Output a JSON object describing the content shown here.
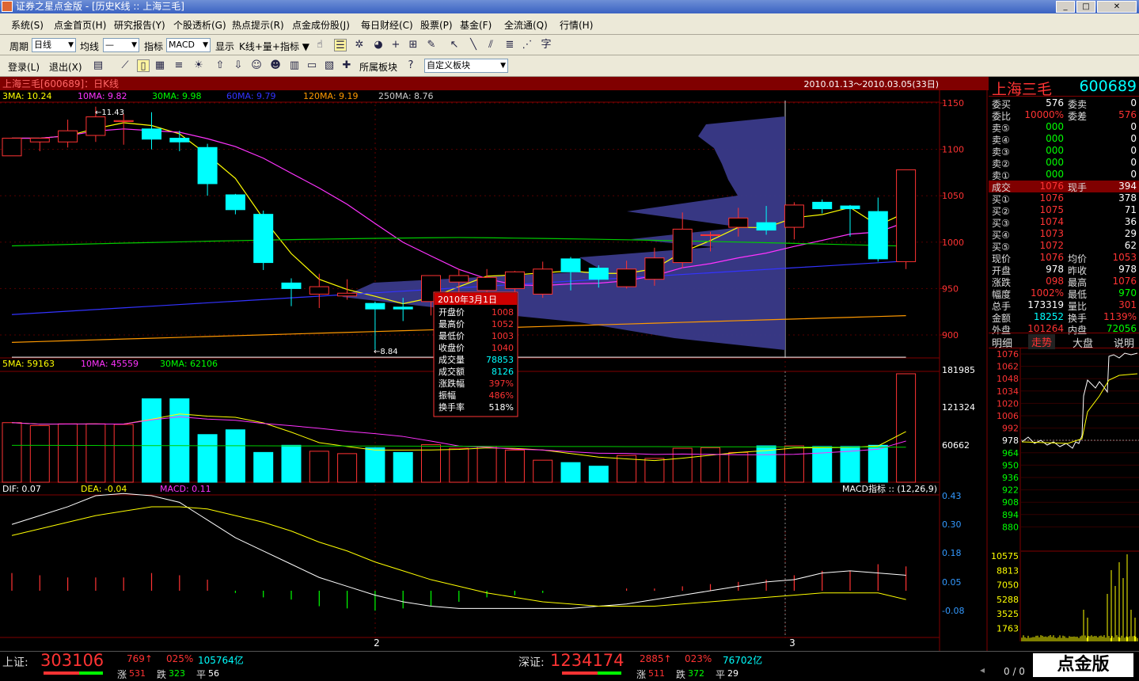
{
  "window": {
    "title": "证券之星点金版 - [历史K线 :: 上海三毛]"
  },
  "menu": [
    "系统(S)",
    "点金首页(H)",
    "研究报告(Y)",
    "个股透析(G)",
    "热点提示(R)",
    "点金成份股(J)",
    "每日财经(C)",
    "股票(P)",
    "基金(F)",
    "全流通(Q)",
    "行情(H)"
  ],
  "toolbar1": {
    "period_label": "周期",
    "period_value": "日线",
    "ma_label": "均线",
    "ma_value": "—",
    "indicator_label": "指标",
    "indicator_value": "MACD",
    "show_label": "显示",
    "show_value": "K线+量+指标",
    "char_icon": "字"
  },
  "toolbar2": {
    "login": "登录(L)",
    "logout": "退出(X)",
    "sector": "所属板块",
    "custom": "自定义板块"
  },
  "chart": {
    "stock_title": "上海三毛[600689]：日K线",
    "date_range": "2010.01.13～2010.03.05(33日)",
    "ma_labels": [
      {
        "t": "3MA: 10.24",
        "c": "#ffff00"
      },
      {
        "t": "10MA: 9.82",
        "c": "#ff33ff"
      },
      {
        "t": "30MA: 9.98",
        "c": "#00ff00"
      },
      {
        "t": "60MA: 9.79",
        "c": "#3333ff"
      },
      {
        "t": "120MA: 9.19",
        "c": "#ff9900"
      },
      {
        "t": "250MA: 8.76",
        "c": "#cccccc"
      }
    ],
    "price_axis": [
      "1150",
      "1100",
      "1050",
      "1000",
      "950",
      "900"
    ],
    "high_mark": "11.43",
    "low_mark": "8.84",
    "vol_labels": [
      {
        "t": "5MA: 59163",
        "c": "#ffff00"
      },
      {
        "t": "10MA: 45559",
        "c": "#ff33ff"
      },
      {
        "t": "30MA: 62106",
        "c": "#00ff00"
      }
    ],
    "vol_axis": [
      "181985",
      "121324",
      "60662"
    ],
    "macd_labels": [
      {
        "t": "DIF: 0.07",
        "c": "#ffffff"
      },
      {
        "t": "DEA: -0.04",
        "c": "#ffff00"
      },
      {
        "t": "MACD: 0.11",
        "c": "#ff33ff"
      }
    ],
    "macd_title": "MACD指标 :: (12,26,9)",
    "macd_axis": [
      "0.43",
      "0.30",
      "0.18",
      "0.05",
      "-0.08"
    ],
    "x_labels": [
      "2",
      "3"
    ],
    "candles": [
      {
        "o": 10.93,
        "c": 11.12,
        "h": 11.12,
        "l": 10.93
      },
      {
        "o": 11.08,
        "c": 11.12,
        "h": 11.12,
        "l": 10.98
      },
      {
        "o": 11.08,
        "c": 11.2,
        "h": 11.32,
        "l": 11.02
      },
      {
        "o": 11.15,
        "c": 11.35,
        "h": 11.46,
        "l": 11.08
      },
      {
        "o": 11.3,
        "c": 11.31,
        "h": 11.38,
        "l": 11.05
      },
      {
        "o": 11.22,
        "c": 11.11,
        "h": 11.4,
        "l": 11.0
      },
      {
        "o": 11.12,
        "c": 11.08,
        "h": 11.2,
        "l": 10.98
      },
      {
        "o": 11.02,
        "c": 10.63,
        "h": 11.06,
        "l": 10.5
      },
      {
        "o": 10.51,
        "c": 10.35,
        "h": 10.52,
        "l": 10.3
      },
      {
        "o": 10.3,
        "c": 9.78,
        "h": 10.34,
        "l": 9.7
      },
      {
        "o": 9.56,
        "c": 9.5,
        "h": 9.61,
        "l": 9.31
      },
      {
        "o": 9.44,
        "c": 9.52,
        "h": 9.66,
        "l": 9.29
      },
      {
        "o": 9.42,
        "c": 9.45,
        "h": 9.6,
        "l": 9.38
      },
      {
        "o": 9.34,
        "c": 9.28,
        "h": 9.36,
        "l": 8.84
      },
      {
        "o": 9.3,
        "c": 9.28,
        "h": 9.4,
        "l": 9.15
      },
      {
        "o": 9.36,
        "c": 9.64,
        "h": 9.64,
        "l": 9.21
      },
      {
        "o": 9.57,
        "c": 9.64,
        "h": 9.71,
        "l": 9.45
      },
      {
        "o": 9.48,
        "c": 9.62,
        "h": 9.71,
        "l": 9.4
      },
      {
        "o": 9.5,
        "c": 9.68,
        "h": 9.69,
        "l": 9.42
      },
      {
        "o": 9.44,
        "c": 9.71,
        "h": 9.79,
        "l": 9.4
      },
      {
        "o": 9.82,
        "c": 9.68,
        "h": 9.84,
        "l": 9.48
      },
      {
        "o": 9.72,
        "c": 9.6,
        "h": 9.75,
        "l": 9.51
      },
      {
        "o": 9.52,
        "c": 9.71,
        "h": 9.8,
        "l": 9.5
      },
      {
        "o": 9.6,
        "c": 9.83,
        "h": 9.94,
        "l": 9.53
      },
      {
        "o": 9.78,
        "c": 10.14,
        "h": 10.32,
        "l": 9.72
      },
      {
        "o": 10.08,
        "c": 10.08,
        "h": 10.11,
        "l": 9.9
      },
      {
        "o": 10.16,
        "c": 10.26,
        "h": 10.37,
        "l": 10.06
      },
      {
        "o": 10.21,
        "c": 10.13,
        "h": 10.39,
        "l": 10.08
      },
      {
        "o": 10.16,
        "c": 10.4,
        "h": 10.43,
        "l": 10.03
      },
      {
        "o": 10.43,
        "c": 10.36,
        "h": 10.46,
        "l": 10.31
      },
      {
        "o": 10.39,
        "c": 10.36,
        "h": 10.4,
        "l": 10.06
      },
      {
        "o": 10.33,
        "c": 9.82,
        "h": 10.48,
        "l": 9.79
      },
      {
        "o": 9.79,
        "c": 10.78,
        "h": 10.78,
        "l": 9.71
      }
    ],
    "volumes": [
      100,
      95,
      98,
      98,
      97,
      140,
      140,
      80,
      88,
      50,
      62,
      52,
      48,
      58,
      50,
      63,
      57,
      60,
      54,
      37,
      33,
      27,
      45,
      40,
      57,
      58,
      50,
      61,
      61,
      60,
      60,
      62,
      182
    ],
    "macd_hist": [
      0.08,
      0.07,
      0.06,
      0.06,
      0.06,
      0.08,
      0.07,
      0.05,
      -0.01,
      -0.03,
      -0.04,
      -0.07,
      -0.08,
      -0.09,
      -0.08,
      -0.07,
      -0.05,
      -0.03,
      -0.02,
      -0.01,
      0.0,
      0.0,
      0.01,
      0.01,
      0.02,
      0.03,
      0.04,
      0.05,
      0.07,
      0.09,
      0.09,
      0.12,
      0.11
    ],
    "dif": [
      0.3,
      0.34,
      0.38,
      0.43,
      0.44,
      0.43,
      0.4,
      0.32,
      0.24,
      0.18,
      0.12,
      0.06,
      0.02,
      -0.02,
      -0.05,
      -0.07,
      -0.08,
      -0.08,
      -0.08,
      -0.08,
      -0.08,
      -0.07,
      -0.06,
      -0.04,
      -0.02,
      0.0,
      0.02,
      0.04,
      0.05,
      0.08,
      0.09,
      0.08,
      0.07
    ],
    "dea": [
      0.25,
      0.28,
      0.31,
      0.34,
      0.36,
      0.38,
      0.38,
      0.37,
      0.34,
      0.31,
      0.27,
      0.22,
      0.18,
      0.13,
      0.09,
      0.05,
      0.02,
      -0.01,
      -0.03,
      -0.05,
      -0.06,
      -0.07,
      -0.07,
      -0.07,
      -0.06,
      -0.05,
      -0.04,
      -0.03,
      -0.02,
      -0.01,
      -0.01,
      -0.01,
      -0.04
    ]
  },
  "tooltip": {
    "date": "2010年3月1日",
    "rows": [
      {
        "k": "开盘价",
        "v": "1008",
        "c": "#ff3333"
      },
      {
        "k": "最高价",
        "v": "1052",
        "c": "#ff3333"
      },
      {
        "k": "最低价",
        "v": "1003",
        "c": "#ff3333"
      },
      {
        "k": "收盘价",
        "v": "1040",
        "c": "#ff3333"
      },
      {
        "k": "成交量",
        "v": "78853",
        "c": "#00ffff"
      },
      {
        "k": "成交额",
        "v": "8126",
        "c": "#00ffff"
      },
      {
        "k": "涨跌幅",
        "v": "397%",
        "c": "#ff3333"
      },
      {
        "k": "振幅",
        "v": "486%",
        "c": "#ff3333"
      },
      {
        "k": "换手率",
        "v": "518%",
        "c": "#ffffff"
      }
    ]
  },
  "quote": {
    "name": "上海三毛",
    "code": "600689",
    "weimai": "委买",
    "weimai_v": "576",
    "weimai2": "委卖",
    "weimai2_v": "0",
    "weibi": "委比",
    "weibi_v": "10000%",
    "weicha": "委差",
    "weicha_v": "576",
    "sell": [
      {
        "k": "卖⑤",
        "p": "000",
        "v": "0"
      },
      {
        "k": "卖④",
        "p": "000",
        "v": "0"
      },
      {
        "k": "卖③",
        "p": "000",
        "v": "0"
      },
      {
        "k": "卖②",
        "p": "000",
        "v": "0"
      },
      {
        "k": "卖①",
        "p": "000",
        "v": "0"
      }
    ],
    "deal": {
      "k": "成交",
      "p": "1076",
      "k2": "现手",
      "v": "394"
    },
    "buy": [
      {
        "k": "买①",
        "p": "1076",
        "v": "378"
      },
      {
        "k": "买②",
        "p": "1075",
        "v": "71"
      },
      {
        "k": "买③",
        "p": "1074",
        "v": "36"
      },
      {
        "k": "买④",
        "p": "1073",
        "v": "29"
      },
      {
        "k": "买⑤",
        "p": "1072",
        "v": "62"
      }
    ],
    "stats": [
      {
        "k": "现价",
        "v": "1076",
        "vc": "#ff3333",
        "k2": "均价",
        "v2": "1053",
        "v2c": "#ff3333"
      },
      {
        "k": "开盘",
        "v": "978",
        "vc": "#ffffff",
        "k2": "昨收",
        "v2": "978",
        "v2c": "#ffffff"
      },
      {
        "k": "涨跌",
        "v": "098",
        "vc": "#ff3333",
        "k2": "最高",
        "v2": "1076",
        "v2c": "#ff3333"
      },
      {
        "k": "幅度",
        "v": "1002%",
        "vc": "#ff3333",
        "k2": "最低",
        "v2": "970",
        "v2c": "#00ff00"
      },
      {
        "k": "总手",
        "v": "173319",
        "vc": "#ffffff",
        "k2": "量比",
        "v2": "301",
        "v2c": "#ff3333"
      },
      {
        "k": "金额",
        "v": "18252",
        "vc": "#00ffff",
        "k2": "换手",
        "v2": "1139%",
        "v2c": "#ff3333"
      },
      {
        "k": "外盘",
        "v": "101264",
        "vc": "#ff3333",
        "k2": "内盘",
        "v2": "72056",
        "v2c": "#00ff00"
      }
    ],
    "tabs": [
      "明细",
      "走势",
      "大盘",
      "说明"
    ],
    "intraday_axis": [
      "1076",
      "1062",
      "1048",
      "1034",
      "1020",
      "1006",
      "992",
      "978",
      "964",
      "950",
      "936",
      "922",
      "908",
      "894",
      "880"
    ],
    "intraday_vol_axis": [
      "10575",
      "8813",
      "7050",
      "5288",
      "3525",
      "1763"
    ]
  },
  "status": {
    "sh_label": "上证:",
    "sh_value": "303106",
    "sh_chg": "769↑",
    "sh_pct": "025%",
    "sh_amt": "105764亿",
    "sh_up_label": "涨",
    "sh_up": "531",
    "sh_down_label": "跌",
    "sh_down": "323",
    "sh_flat_label": "平",
    "sh_flat": "56",
    "sz_label": "深证:",
    "sz_value": "1234174",
    "sz_chg": "2885↑",
    "sz_pct": "023%",
    "sz_amt": "76702亿",
    "sz_up_label": "涨",
    "sz_up": "511",
    "sz_down_label": "跌",
    "sz_down": "372",
    "sz_flat_label": "平",
    "sz_flat": "29",
    "page": "0 / 0",
    "brand": "点金版"
  },
  "colors": {
    "up": "#ff3333",
    "down": "#00ffff",
    "bg": "#000000",
    "grid": "#800000"
  }
}
